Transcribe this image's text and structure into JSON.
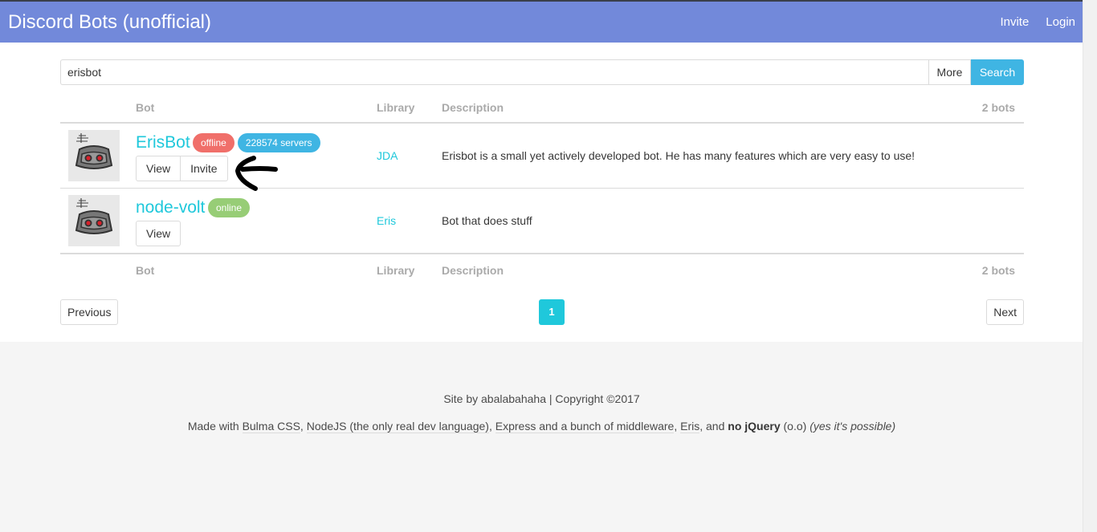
{
  "navbar": {
    "brand": "Discord Bots (unofficial)",
    "links": [
      "Invite",
      "Login"
    ],
    "color": "#7289da"
  },
  "search": {
    "value": "erisbot",
    "more_label": "More",
    "search_label": "Search"
  },
  "table": {
    "columns": {
      "bot": "Bot",
      "library": "Library",
      "description": "Description",
      "count": "2 bots"
    },
    "rows": [
      {
        "name": "ErisBot",
        "status": "offline",
        "servers": "228574 servers",
        "view_label": "View",
        "invite_label": "Invite",
        "library": "JDA",
        "description": "Erisbot is a small yet actively developed bot. He has many features which are very easy to use!"
      },
      {
        "name": "node-volt",
        "status": "online",
        "view_label": "View",
        "library": "Eris",
        "description": "Bot that does stuff"
      }
    ]
  },
  "pagination": {
    "previous": "Previous",
    "current": "1",
    "next": "Next"
  },
  "footer": {
    "line1": "Site by abalabahaha | Copyright ©2017",
    "made_with": "Made with",
    "bulma": "Bulma CSS",
    "nodejs": "NodeJS (the only real dev language)",
    "express": "Express and a bunch of middleware",
    "eris": "Eris",
    "and": ", and",
    "no_jquery": "no jQuery",
    "face": "(o.o)",
    "possible": "(yes it's possible)"
  },
  "colors": {
    "offline": "#f06f6a",
    "online": "#97cd76",
    "servers": "#3fb5e3",
    "link": "#1fc8db"
  }
}
